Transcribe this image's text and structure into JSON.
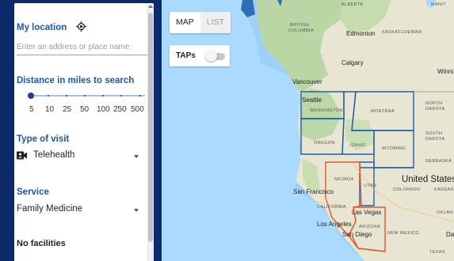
{
  "sidebar": {
    "location": {
      "title": "My location",
      "icon": "crosshair-icon",
      "placeholder": "Enter an address or place name"
    },
    "distance": {
      "title": "Distance in miles to search",
      "options": [
        "5",
        "10",
        "25",
        "50",
        "100",
        "250",
        "500"
      ],
      "selected": "5"
    },
    "visit_type": {
      "title": "Type of visit",
      "icon": "video-icon",
      "selected": "Telehealth"
    },
    "service": {
      "title": "Service",
      "selected": "Family Medicine"
    },
    "results_text": "No facilities"
  },
  "map": {
    "view_toggle": {
      "map_label": "MAP",
      "list_label": "LIST",
      "active": "MAP"
    },
    "taps": {
      "label": "TAPs",
      "enabled": false
    },
    "labels": {
      "alberta": "ALBERTA",
      "manitoba": "MANIT",
      "british_columbia_1": "BRITISH",
      "british_columbia_2": "COLUMBIA",
      "edmonton": "Edmonton",
      "saskatchewan": "SASKATCHEWAN",
      "calgary": "Calgary",
      "winnipeg": "Winni",
      "vancouver": "Vancouver",
      "seattle": "Seattle",
      "washington": "WASHINGTON",
      "montana": "MONTANA",
      "north_dakota_1": "NORTH",
      "north_dakota_2": "DAKOTA",
      "oregon": "OREGON",
      "idaho": "IDAHO",
      "south_dakota_1": "SOUTH",
      "south_dakota_2": "DAKOTA",
      "wyoming": "WYOMING",
      "nebraska": "NEBRASKA",
      "nevada": "NEVADA",
      "united_states": "United States",
      "utah": "UTAH",
      "colorado": "COLORADO",
      "kansas": "KANSAS",
      "san_francisco": "San Francisco",
      "california": "CALIFORNIA",
      "las_vegas": "Las Vegas",
      "oklahoma": "OKLAH",
      "los_angeles": "Los Angeles",
      "arizona": "ARIZONA",
      "san_diego": "San Diego",
      "new_mexico": "NEW MEXICO",
      "dallas": "Dal",
      "texas": "TEXAS"
    },
    "colors": {
      "region_blue": "#1f5fb0",
      "region_orange": "#e0572a",
      "land": "#e9e5d3",
      "forest": "#b9d6a4",
      "water": "#aadaff"
    }
  }
}
